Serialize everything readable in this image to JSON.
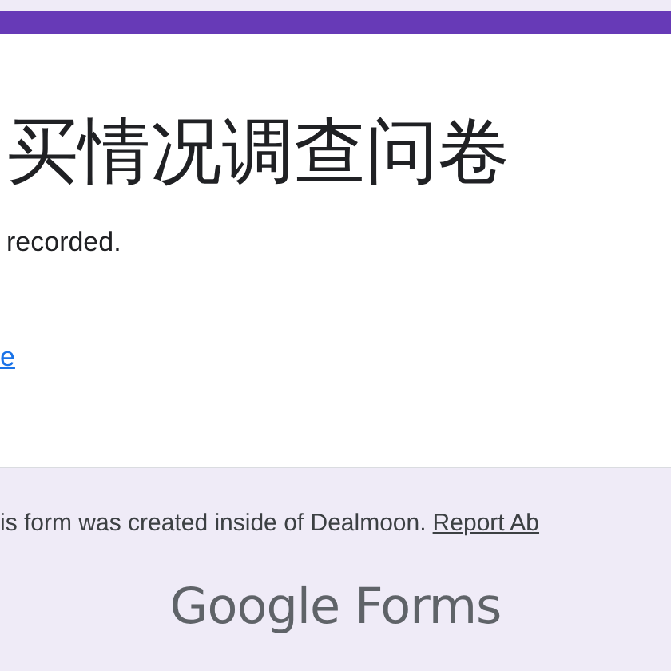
{
  "form": {
    "title": "买情况调查问卷",
    "message": "recorded.",
    "link": "e"
  },
  "footer": {
    "notice": "is form was created inside of Dealmoon.",
    "report_link": "Report Ab",
    "brand": "Google Forms"
  }
}
